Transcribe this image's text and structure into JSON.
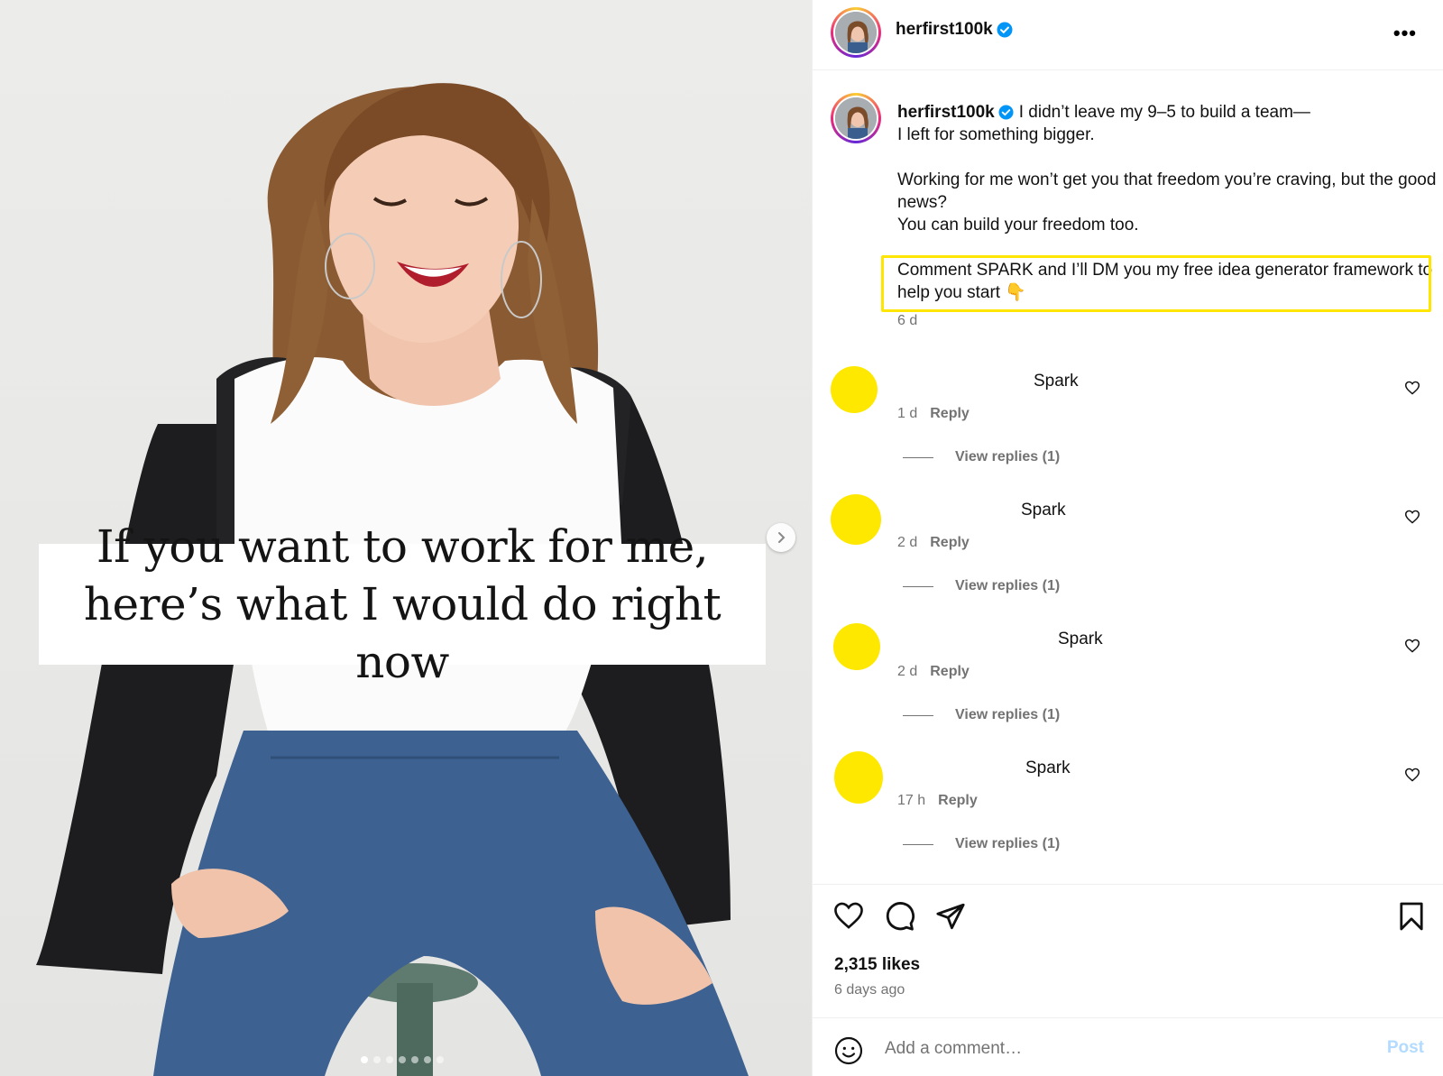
{
  "post": {
    "username": "herfirst100k",
    "overlay_text": "If you want to work for me, here’s what I would do right now",
    "caption_line1": "I didn’t leave my 9–5 to build a team—",
    "caption_line2": "I left for something bigger.",
    "caption_line3": "Working for me won’t get you that freedom you’re craving, but the good news?",
    "caption_line4": "You can build your freedom too.",
    "caption_cta": "Comment SPARK and I’ll DM you my free idea generator framework to help you start 👇",
    "caption_time": "6 d",
    "likes": "2,315 likes",
    "posted": "6 days ago"
  },
  "comments": [
    {
      "text": "Spark",
      "time": "1 d",
      "reply": "Reply",
      "view_replies": "View replies (1)"
    },
    {
      "text": "Spark",
      "time": "2 d",
      "reply": "Reply",
      "view_replies": "View replies (1)"
    },
    {
      "text": "Spark",
      "time": "2 d",
      "reply": "Reply",
      "view_replies": "View replies (1)"
    },
    {
      "text": "Spark",
      "time": "17 h",
      "reply": "Reply",
      "view_replies": "View replies (1)"
    }
  ],
  "composer": {
    "placeholder": "Add a comment…",
    "post_label": "Post"
  },
  "colors": {
    "highlight": "#ffe600",
    "comment_avatar": "#ffe800",
    "verified": "#0095f6",
    "post_button": "#b3dbff"
  },
  "carousel": {
    "slides": 7,
    "current": 1
  }
}
